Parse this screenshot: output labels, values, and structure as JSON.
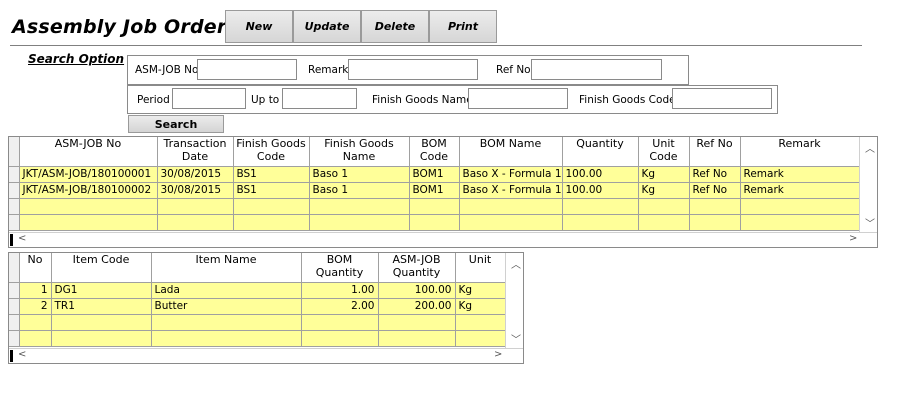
{
  "title": "Assembly Job Order",
  "toolbar": {
    "new_label": "New",
    "update_label": "Update",
    "delete_label": "Delete",
    "print_label": "Print"
  },
  "search": {
    "section_label": "Search Option",
    "asm_job_no_label": "ASM-JOB No",
    "asm_job_no_value": "",
    "remark_label": "Remark",
    "remark_value": "",
    "ref_no_label": "Ref No",
    "ref_no_value": "",
    "period_label": "Period",
    "period_from_value": "",
    "up_to_label": "Up to",
    "period_to_value": "",
    "finish_goods_name_label": "Finish Goods Name",
    "finish_goods_name_value": "",
    "finish_goods_code_label": "Finish Goods Code",
    "finish_goods_code_value": "",
    "search_button_label": "Search"
  },
  "master_grid": {
    "headers": [
      "ASM-JOB No",
      "Transaction Date",
      "Finish Goods Code",
      "Finish Goods Name",
      "BOM Code",
      "BOM Name",
      "Quantity",
      "Unit Code",
      "Ref No",
      "Remark"
    ],
    "rows": [
      [
        "JKT/ASM-JOB/180100001",
        "30/08/2015",
        "BS1",
        "Baso 1",
        "BOM1",
        "Baso X - Formula 1",
        "100.00",
        "Kg",
        "Ref No",
        "Remark"
      ],
      [
        "JKT/ASM-JOB/180100002",
        "30/08/2015",
        "BS1",
        "Baso 1",
        "BOM1",
        "Baso X - Formula 1",
        "100.00",
        "Kg",
        "Ref No",
        "Remark"
      ]
    ],
    "empty_rows": 2
  },
  "detail_grid": {
    "headers": [
      "No",
      "Item Code",
      "Item Name",
      "BOM Quantity",
      "ASM-JOB Quantity",
      "Unit"
    ],
    "rows": [
      [
        "1",
        "DG1",
        "Lada",
        "1.00",
        "100.00",
        "Kg"
      ],
      [
        "2",
        "TR1",
        "Butter",
        "2.00",
        "200.00",
        "Kg"
      ]
    ],
    "empty_rows": 2
  },
  "icons": {
    "scroll_up": "scroll-up-icon",
    "scroll_down": "scroll-down-icon",
    "scroll_left": "scroll-left-icon",
    "scroll_right": "scroll-right-icon"
  },
  "colors": {
    "grid_row_bg": "#ffff99",
    "button_bg": "#e0e0e0"
  }
}
